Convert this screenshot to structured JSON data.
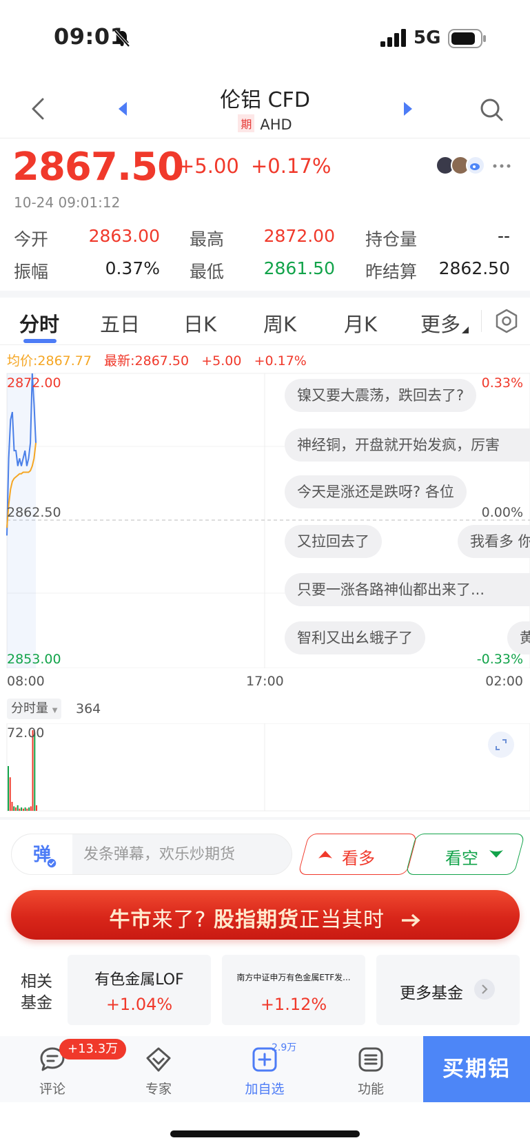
{
  "status_bar": {
    "time": "09:01",
    "network": "5G"
  },
  "header": {
    "title": "伦铝 CFD",
    "tag": "期",
    "code": "AHD"
  },
  "quote": {
    "price": "2867.50",
    "change": "+5.00",
    "change_pct": "+0.17%",
    "timestamp": "10-24 09:01:12",
    "stats": [
      {
        "label": "今开",
        "value": "2863.00"
      },
      {
        "label": "最高",
        "value": "2872.00"
      },
      {
        "label": "持仓量",
        "value": "--"
      },
      {
        "label": "振幅",
        "value": "0.37%"
      },
      {
        "label": "最低",
        "value": "2861.50"
      },
      {
        "label": "昨结算",
        "value": "2862.50"
      }
    ]
  },
  "tabs": [
    "分时",
    "五日",
    "日K",
    "周K",
    "月K",
    "更多"
  ],
  "chart_legend": {
    "avg": "均价:2867.77",
    "latest": "最新:2867.50",
    "change": "+5.00",
    "change_pct": "+0.17%"
  },
  "chart_data": {
    "type": "line",
    "y_labels_left": [
      "2872.00",
      "2862.50",
      "2853.00"
    ],
    "y_labels_right": [
      "0.33%",
      "0.00%",
      "-0.33%"
    ],
    "x_labels": [
      "08:00",
      "17:00",
      "02:00"
    ],
    "ylim": [
      2853.0,
      2872.0
    ],
    "reference": 2862.5,
    "series": [
      {
        "values": [
          2861.5,
          2866.5,
          2869.0,
          2869.5,
          2867.0,
          2867.0,
          2866.0,
          2866.5,
          2866.0,
          2866.5,
          2867.0,
          2866.0,
          2866.5,
          2867.5,
          2872.0,
          2870.0,
          2867.5
        ]
      },
      {
        "values": [
          2862.0,
          2863.5,
          2864.5,
          2865.0,
          2865.2,
          2865.3,
          2865.4,
          2865.5,
          2865.5,
          2865.6,
          2865.6,
          2865.6,
          2865.6,
          2865.7,
          2866.0,
          2866.5,
          2867.5
        ]
      }
    ]
  },
  "danmaku": [
    "镍又要大震荡，跌回去了?",
    "神经铜，开盘就开始发疯，厉害",
    "今天是涨还是跌呀? 各位",
    "又拉回去了",
    "我看多 你",
    "只要一涨各路神仙都出来了...",
    "智利又出幺蛾子了",
    "黄"
  ],
  "volume": {
    "label": "分时量",
    "value": "364",
    "max_label": "72.00",
    "bars": [
      {
        "v": 40,
        "up": false
      },
      {
        "v": 30,
        "up": true
      },
      {
        "v": 8,
        "up": true
      },
      {
        "v": 4,
        "up": false
      },
      {
        "v": 3,
        "up": true
      },
      {
        "v": 5,
        "up": false
      },
      {
        "v": 2,
        "up": true
      },
      {
        "v": 3,
        "up": false
      },
      {
        "v": 2,
        "up": true
      },
      {
        "v": 3,
        "up": false
      },
      {
        "v": 2,
        "up": true
      },
      {
        "v": 3,
        "up": false
      },
      {
        "v": 4,
        "up": true
      },
      {
        "v": 72,
        "up": true
      },
      {
        "v": 70,
        "up": false
      },
      {
        "v": 5,
        "up": true
      }
    ]
  },
  "input": {
    "prefix": "弹",
    "placeholder": "发条弹幕，欢乐炒期货"
  },
  "actions": {
    "bull": "看多",
    "bear": "看空"
  },
  "banner": {
    "part1": "牛市",
    "part2": "来了? ",
    "part3": "股指期货",
    "part4": "正当其时"
  },
  "funds": {
    "label": "相关基金",
    "items": [
      {
        "name": "有色金属LOF",
        "pct": "+1.04%"
      },
      {
        "name": "南方中证申万有色金属ETF发...",
        "pct": "+1.12%"
      }
    ],
    "more": "更多基金"
  },
  "bottom_nav": {
    "items": [
      {
        "label": "评论",
        "badge": "+13.3万"
      },
      {
        "label": "专家"
      },
      {
        "label": "加自选",
        "badge": "2.9万"
      },
      {
        "label": "功能"
      }
    ],
    "buy": "买期铝"
  },
  "colors": {
    "up": "#f0392b",
    "down": "#12a34a",
    "accent": "#4d7cf6",
    "avg_line": "#f5a623",
    "price_line": "#4a7fe8"
  }
}
